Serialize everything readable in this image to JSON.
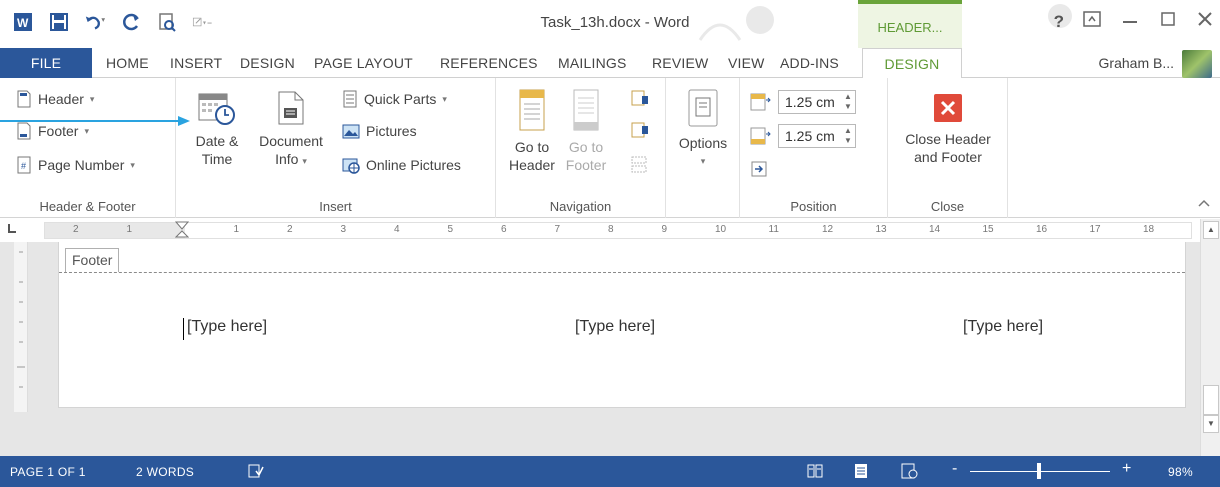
{
  "window": {
    "title": "Task_13h.docx - Word",
    "context_tab_title": "HEADER...",
    "help": "?",
    "controls": [
      "restore-icon",
      "minimize-icon",
      "maximize-icon",
      "close-icon"
    ]
  },
  "tabs": [
    {
      "label": "FILE"
    },
    {
      "label": "HOME"
    },
    {
      "label": "INSERT"
    },
    {
      "label": "DESIGN"
    },
    {
      "label": "PAGE LAYOUT"
    },
    {
      "label": "REFERENCES"
    },
    {
      "label": "MAILINGS"
    },
    {
      "label": "REVIEW"
    },
    {
      "label": "VIEW"
    },
    {
      "label": "ADD-INS"
    },
    {
      "label": "DESIGN"
    }
  ],
  "user": {
    "name": "Graham B..."
  },
  "ribbon": {
    "header_footer": {
      "label": "Header & Footer",
      "header": "Header",
      "footer": "Footer",
      "page_number": "Page Number"
    },
    "insert": {
      "label": "Insert",
      "date_time_1": "Date &",
      "date_time_2": "Time",
      "doc_info_1": "Document",
      "doc_info_2": "Info",
      "quick_parts": "Quick Parts",
      "pictures": "Pictures",
      "online_pictures": "Online Pictures"
    },
    "navigation": {
      "label": "Navigation",
      "goto_header_1": "Go to",
      "goto_header_2": "Header",
      "goto_footer_1": "Go to",
      "goto_footer_2": "Footer"
    },
    "options": {
      "label": "Options"
    },
    "position": {
      "label": "Position",
      "header_from_top": "1.25 cm",
      "footer_from_bottom": "1.25 cm"
    },
    "close": {
      "label": "Close",
      "btn_1": "Close Header",
      "btn_2": "and Footer"
    }
  },
  "ruler": {
    "numbers": [
      "2",
      "1",
      "1",
      "2",
      "3",
      "4",
      "5",
      "6",
      "7",
      "8",
      "9",
      "10",
      "11",
      "12",
      "13",
      "14",
      "15",
      "16",
      "17",
      "18"
    ]
  },
  "document": {
    "footer_tag": "Footer",
    "placeholders": [
      "[Type here]",
      "[Type here]",
      "[Type here]"
    ]
  },
  "status": {
    "page": "PAGE 1 OF 1",
    "words": "2 WORDS",
    "zoom_minus": "-",
    "zoom_plus": "+",
    "zoom": "98%",
    "zoom_level": 0.49
  },
  "colors": {
    "accent": "#2b579a",
    "context_green": "#6aa43a",
    "close_red": "#e04a3a",
    "pointer": "#2aa3e0"
  }
}
